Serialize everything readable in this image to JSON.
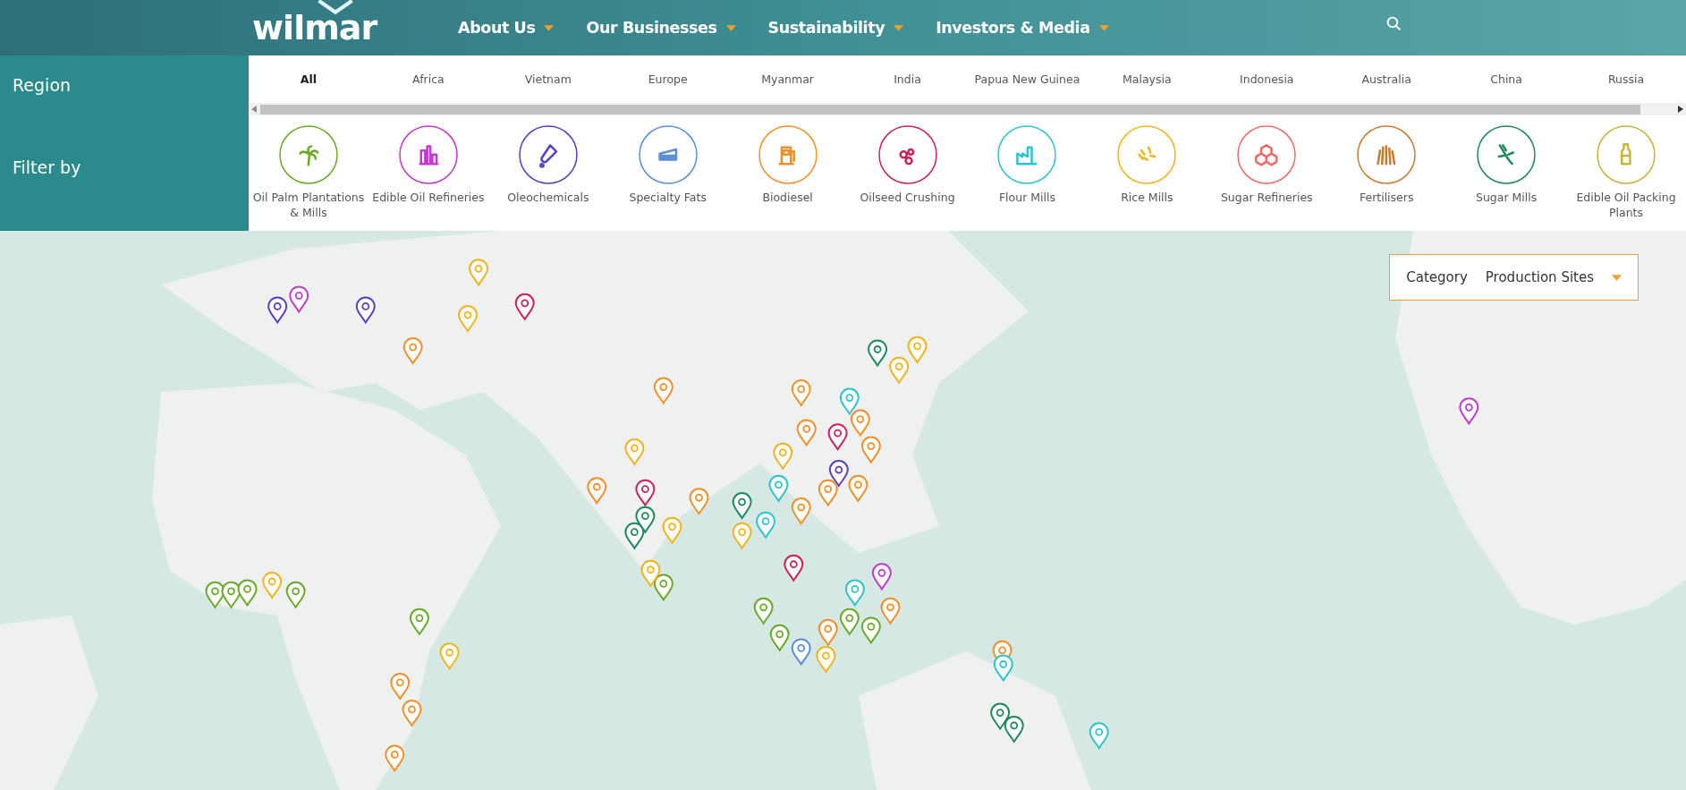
{
  "header": {
    "logo": "wilmar",
    "nav": [
      {
        "label": "About Us"
      },
      {
        "label": "Our Businesses"
      },
      {
        "label": "Sustainability"
      },
      {
        "label": "Investors & Media"
      }
    ]
  },
  "sidebar": {
    "region_label": "Region",
    "filter_label": "Filter by"
  },
  "regions": [
    {
      "label": "All",
      "selected": true
    },
    {
      "label": "Africa",
      "selected": false
    },
    {
      "label": "Vietnam",
      "selected": false
    },
    {
      "label": "Europe",
      "selected": false
    },
    {
      "label": "Myanmar",
      "selected": false
    },
    {
      "label": "India",
      "selected": false
    },
    {
      "label": "Papua New Guinea",
      "selected": false
    },
    {
      "label": "Malaysia",
      "selected": false
    },
    {
      "label": "Indonesia",
      "selected": false
    },
    {
      "label": "Australia",
      "selected": false
    },
    {
      "label": "China",
      "selected": false
    },
    {
      "label": "Russia",
      "selected": false
    }
  ],
  "filters": [
    {
      "label": "Oil Palm Plantations & Mills",
      "kind": "palm",
      "color": "#6aaa2a"
    },
    {
      "label": "Edible Oil Refineries",
      "kind": "refinery",
      "color": "#c03ccc"
    },
    {
      "label": "Oleochemicals",
      "kind": "flask",
      "color": "#5a3fc0"
    },
    {
      "label": "Specialty Fats",
      "kind": "cake",
      "color": "#5a8fd8"
    },
    {
      "label": "Biodiesel",
      "kind": "pump",
      "color": "#f0902a"
    },
    {
      "label": "Oilseed Crushing",
      "kind": "beans",
      "color": "#c8245a"
    },
    {
      "label": "Flour Mills",
      "kind": "factory",
      "color": "#2ec4cc"
    },
    {
      "label": "Rice Mills",
      "kind": "grains",
      "color": "#f0b41e"
    },
    {
      "label": "Sugar Refineries",
      "kind": "cubes",
      "color": "#f06a6a"
    },
    {
      "label": "Fertilisers",
      "kind": "grass",
      "color": "#c87a30"
    },
    {
      "label": "Sugar Mills",
      "kind": "cane",
      "color": "#1e8a5a"
    },
    {
      "label": "Edible Oil Packing Plants",
      "kind": "bottle",
      "color": "#c8b43c"
    }
  ],
  "category": {
    "label": "Category",
    "value": "Production Sites"
  }
}
